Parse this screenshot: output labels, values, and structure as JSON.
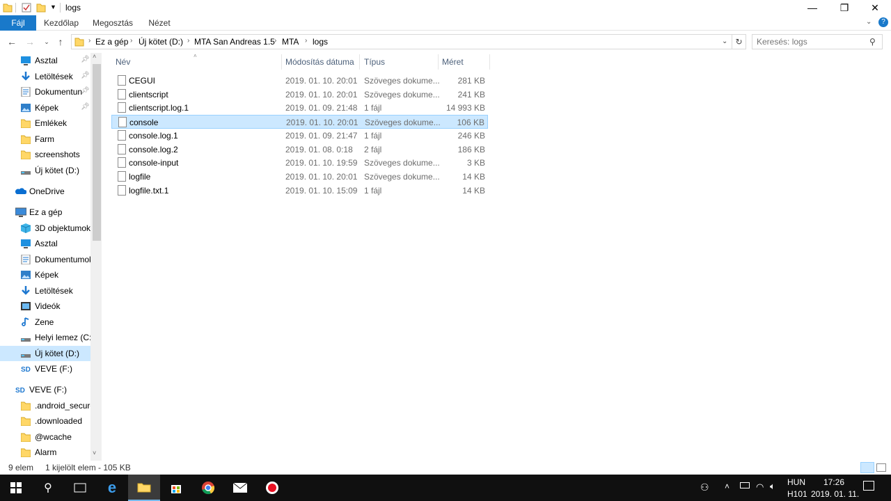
{
  "window": {
    "title": "logs",
    "controls": {
      "minimize": "—",
      "restore": "❐",
      "close": "✕"
    }
  },
  "ribbon": {
    "tabs": [
      "Fájl",
      "Kezdőlap",
      "Megosztás",
      "Nézet"
    ]
  },
  "address": {
    "crumbs": [
      "Ez a gép",
      "Új kötet (D:)",
      "MTA San Andreas 1.5",
      "MTA",
      "logs"
    ],
    "search_placeholder": "Keresés: logs"
  },
  "columns": {
    "name": "Név",
    "date": "Módosítás dátuma",
    "type": "Típus",
    "size": "Méret"
  },
  "files": [
    {
      "name": "CEGUI",
      "date": "2019. 01. 10. 20:01",
      "type": "Szöveges dokume...",
      "size": "281 KB"
    },
    {
      "name": "clientscript",
      "date": "2019. 01. 10. 20:01",
      "type": "Szöveges dokume...",
      "size": "241 KB"
    },
    {
      "name": "clientscript.log.1",
      "date": "2019. 01. 09. 21:48",
      "type": "1 fájl",
      "size": "14 993 KB"
    },
    {
      "name": "console",
      "date": "2019. 01. 10. 20:01",
      "type": "Szöveges dokume...",
      "size": "106 KB"
    },
    {
      "name": "console.log.1",
      "date": "2019. 01. 09. 21:47",
      "type": "1 fájl",
      "size": "246 KB"
    },
    {
      "name": "console.log.2",
      "date": "2019. 01. 08. 0:18",
      "type": "2 fájl",
      "size": "186 KB"
    },
    {
      "name": "console-input",
      "date": "2019. 01. 10. 19:59",
      "type": "Szöveges dokume...",
      "size": "3 KB"
    },
    {
      "name": "logfile",
      "date": "2019. 01. 10. 20:01",
      "type": "Szöveges dokume...",
      "size": "14 KB"
    },
    {
      "name": "logfile.txt.1",
      "date": "2019. 01. 10. 15:09",
      "type": "1 fájl",
      "size": "14 KB"
    }
  ],
  "nav": [
    {
      "label": "Asztal",
      "icon": "desktop-icon",
      "pinned": true
    },
    {
      "label": "Letöltések",
      "icon": "download-icon",
      "pinned": true
    },
    {
      "label": "Dokumentun",
      "icon": "documents-icon",
      "pinned": true
    },
    {
      "label": "Képek",
      "icon": "pictures-icon",
      "pinned": true
    },
    {
      "label": "Emlékek",
      "icon": "folder-icon"
    },
    {
      "label": "Farm",
      "icon": "folder-icon"
    },
    {
      "label": "screenshots",
      "icon": "folder-icon"
    },
    {
      "label": "Új kötet (D:)",
      "icon": "drive-icon"
    },
    {
      "label": "OneDrive",
      "icon": "onedrive-icon"
    },
    {
      "label": "Ez a gép",
      "icon": "computer-icon"
    },
    {
      "label": "3D objektumok",
      "icon": "3d-objects-icon"
    },
    {
      "label": "Asztal",
      "icon": "desktop-icon"
    },
    {
      "label": "Dokumentumok",
      "icon": "documents-icon"
    },
    {
      "label": "Képek",
      "icon": "pictures-icon"
    },
    {
      "label": "Letöltések",
      "icon": "download-icon"
    },
    {
      "label": "Videók",
      "icon": "videos-icon"
    },
    {
      "label": "Zene",
      "icon": "music-icon"
    },
    {
      "label": "Helyi lemez (C:)",
      "icon": "drive-icon"
    },
    {
      "label": "Új kötet (D:)",
      "icon": "drive-icon"
    },
    {
      "label": "VEVE (F:)",
      "icon": "sd-card-icon"
    },
    {
      "label": "VEVE (F:)",
      "icon": "sd-card-icon"
    },
    {
      "label": ".android_secure",
      "icon": "folder-icon"
    },
    {
      "label": ".downloaded",
      "icon": "folder-icon"
    },
    {
      "label": "@wcache",
      "icon": "folder-icon"
    },
    {
      "label": "Alarm",
      "icon": "folder-icon"
    }
  ],
  "status": {
    "count": "9 elem",
    "selection": "1 kijelölt elem - 105 KB"
  },
  "taskbar": {
    "lang": "HUN",
    "layout": "H101",
    "time": "17:26",
    "date": "2019. 01. 11."
  },
  "colors": {
    "accent": "#1979ca",
    "selection": "#cce8ff",
    "folder": "#ffd767"
  }
}
